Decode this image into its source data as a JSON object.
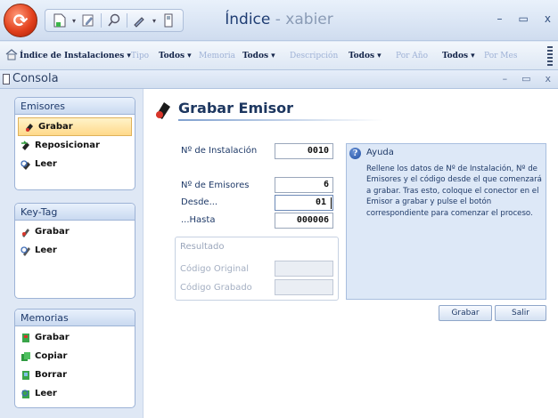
{
  "window": {
    "title_main": "Índice",
    "title_sep": " - ",
    "title_app": "xabier",
    "min": "–",
    "max": "▭",
    "close": "x"
  },
  "filterbar": {
    "indice": "Índice de Instalaciones",
    "tipo": "Tipo",
    "todos1": "Todos",
    "memoria": "Memoria",
    "todos2": "Todos",
    "descripcion": "Descripción",
    "todos3": "Todos",
    "por_anio": "Por Año",
    "todos4": "Todos",
    "por_mes": "Por Mes"
  },
  "console": {
    "title": "Consola",
    "min": "–",
    "max": "▭",
    "close": "x"
  },
  "sidebar": {
    "emisores": {
      "title": "Emisores",
      "items": [
        "Grabar",
        "Reposicionar",
        "Leer"
      ]
    },
    "keytag": {
      "title": "Key-Tag",
      "items": [
        "Grabar",
        "Leer"
      ]
    },
    "memorias": {
      "title": "Memorias",
      "items": [
        "Grabar",
        "Copiar",
        "Borrar",
        "Leer"
      ]
    }
  },
  "form": {
    "heading": "Grabar Emisor",
    "instalacion_label": "Nº de Instalación",
    "instalacion_value": "0010",
    "emisores_label": "Nº de Emisores",
    "emisores_value": "6",
    "desde_label": "Desde...",
    "desde_value": "01",
    "hasta_label": "...Hasta",
    "hasta_value": "000006"
  },
  "resultado": {
    "title": "Resultado",
    "original_label": "Código Original",
    "grabado_label": "Código Grabado"
  },
  "ayuda": {
    "title": "Ayuda",
    "text": "Rellene los datos de Nº de Instalación, Nº de Emisores y el código desde el que comenzará a grabar. Tras esto, coloque el conector en el Emisor a grabar y pulse el botón correspondiente para comenzar el proceso."
  },
  "buttons": {
    "grabar": "Grabar",
    "salir": "Salir"
  }
}
